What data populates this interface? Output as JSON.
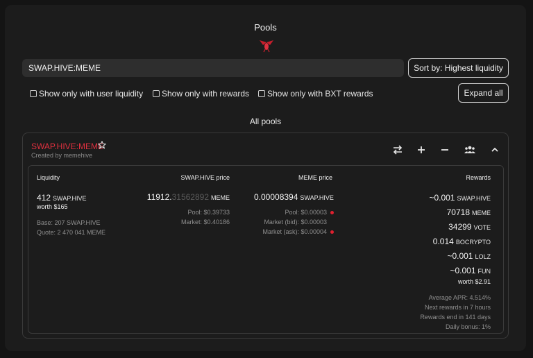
{
  "header": {
    "title": "Pools"
  },
  "colors": {
    "accent": "#e0303f",
    "background": "#1c1c1c",
    "input": "#2e2e2e"
  },
  "search": {
    "value": "SWAP.HIVE:MEME"
  },
  "sort": {
    "label": "Sort by: Highest liquidity"
  },
  "filters": [
    {
      "label": "Show only with user liquidity",
      "checked": false
    },
    {
      "label": "Show only with rewards",
      "checked": false
    },
    {
      "label": "Show only with BXT rewards",
      "checked": false
    }
  ],
  "expand": {
    "label": "Expand all"
  },
  "section": {
    "label": "All pools"
  },
  "pool": {
    "name": "SWAP.HIVE:MEME",
    "created_by": "Created by memehive",
    "actions": [
      "swap-icon",
      "plus-icon",
      "minus-icon",
      "users-icon",
      "chevron-up-icon"
    ],
    "liquidity": {
      "header": "Liquidity",
      "amount": "412",
      "unit": "SWAP.HIVE",
      "worth": "worth $165",
      "base": "Base: 207 SWAP.HIVE",
      "quote": "Quote: 2 470 041 MEME"
    },
    "price_a": {
      "header": "SWAP.HIVE price",
      "value_main": "11912.",
      "value_dim": "31562892",
      "unit": "MEME",
      "pool": "Pool: $0.39733",
      "market": "Market: $0.40186"
    },
    "price_b": {
      "header": "MEME price",
      "value": "0.00008394",
      "unit": "SWAP.HIVE",
      "pool": "Pool: $0.00003",
      "market_bid": "Market (bid): $0.00003",
      "market_ask": "Market (ask): $0.00004"
    },
    "rewards": {
      "header": "Rewards",
      "items": [
        {
          "amount": "~0.001",
          "token": "SWAP.HIVE"
        },
        {
          "amount": "70718",
          "token": "MEME"
        },
        {
          "amount": "34299",
          "token": "VOTE"
        },
        {
          "amount": "0.014",
          "token": "BOCRYPTO"
        },
        {
          "amount": "~0.001",
          "token": "LOLZ"
        },
        {
          "amount": "~0.001",
          "token": "FUN"
        }
      ],
      "worth": "worth $2.91",
      "apr": "Average APR: 4.514%",
      "next": "Next rewards in 7 hours",
      "end": "Rewards end in 141 days",
      "daily": "Daily bonus: 1%"
    }
  }
}
